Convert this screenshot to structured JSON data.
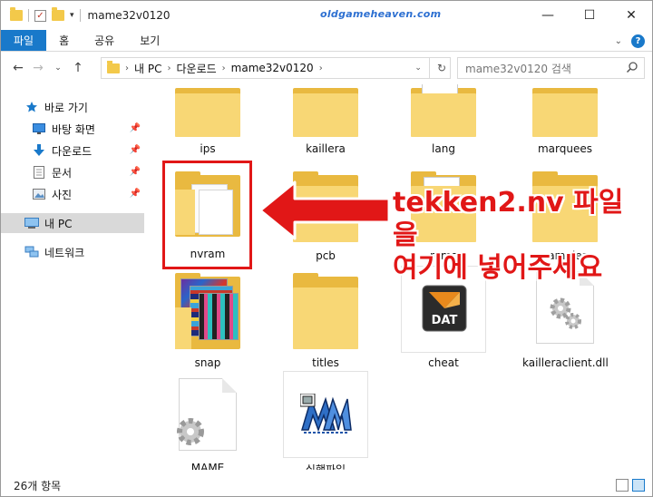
{
  "window": {
    "title": "mame32v0120"
  },
  "watermark": "oldgameheaven.com",
  "window_buttons": {
    "minimize": "—",
    "maximize": "☐",
    "close": "✕"
  },
  "ribbon": {
    "tabs": [
      "파일",
      "홈",
      "공유",
      "보기"
    ]
  },
  "address": {
    "segments": [
      "내 PC",
      "다운로드",
      "mame32v0120"
    ],
    "refresh_icon": "↻"
  },
  "search": {
    "placeholder": "mame32v0120 검색"
  },
  "nav": {
    "quick_access": "바로 가기",
    "items": [
      "바탕 화면",
      "다운로드",
      "문서",
      "사진"
    ],
    "this_pc": "내 PC",
    "network": "네트워크"
  },
  "files": [
    {
      "name": "ips",
      "kind": "folder"
    },
    {
      "name": "kaillera",
      "kind": "folder"
    },
    {
      "name": "lang",
      "kind": "folder-docs"
    },
    {
      "name": "marquees",
      "kind": "folder"
    },
    {
      "name": "nvram",
      "kind": "folder-open"
    },
    {
      "name": "pcb",
      "kind": "folder"
    },
    {
      "name": "roms",
      "kind": "folder-docs"
    },
    {
      "name": "samples",
      "kind": "folder"
    },
    {
      "name": "snap",
      "kind": "folder-images"
    },
    {
      "name": "titles",
      "kind": "folder"
    },
    {
      "name": "cheat",
      "kind": "dat-file"
    },
    {
      "name": "kailleraclient.dll",
      "kind": "dll-file"
    },
    {
      "name": "MAME",
      "kind": "config-file"
    },
    {
      "name": "실행파일",
      "kind": "mame-exe"
    }
  ],
  "callout": {
    "line1": "tekken2.nv 파일을",
    "line2": "여기에 넣어주세요"
  },
  "dat_badge": "DAT",
  "status": {
    "count": "26개 항목"
  },
  "colors": {
    "accent": "#1979ca",
    "highlight": "#e11717",
    "folder": "#f8d775"
  }
}
